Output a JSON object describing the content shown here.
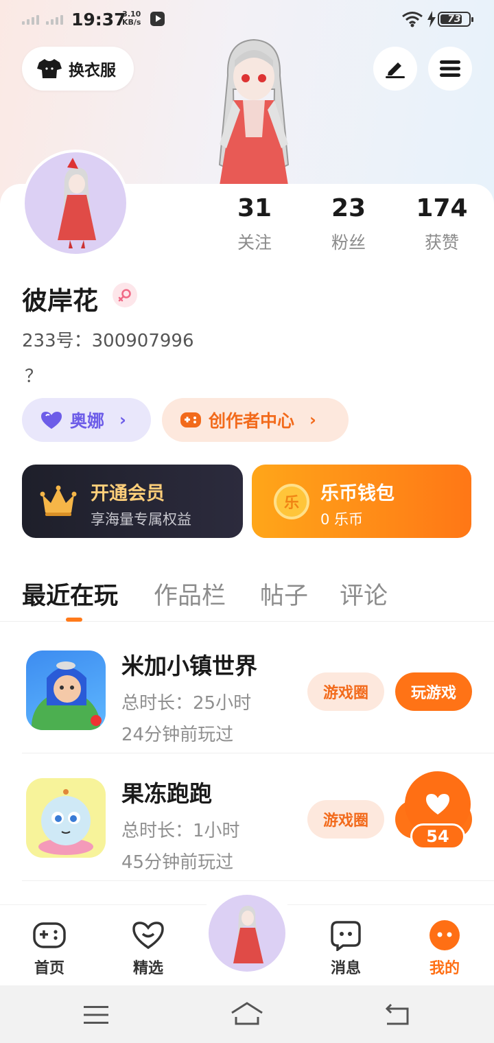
{
  "status_bar": {
    "time": "19:37",
    "net_speed_value": "3.10",
    "net_speed_unit": "KB/s",
    "battery": "73"
  },
  "header": {
    "outfit_label": "换衣服",
    "icons": [
      "tshirt-icon",
      "edit-icon",
      "menu-icon"
    ]
  },
  "profile": {
    "stats": [
      {
        "value": "31",
        "label": "关注"
      },
      {
        "value": "23",
        "label": "粉丝"
      },
      {
        "value": "174",
        "label": "获赞"
      }
    ],
    "nickname": "彼岸花",
    "gender": "female",
    "user_id": "233号：300907996",
    "bio": "？"
  },
  "pills": {
    "ona_label": "奥娜",
    "creator_label": "创作者中心"
  },
  "cards": {
    "vip": {
      "title": "开通会员",
      "subtitle": "享海量专属权益"
    },
    "wallet": {
      "title": "乐币钱包",
      "subtitle": "0 乐币",
      "coin_glyph": "乐"
    }
  },
  "tabs": [
    {
      "label": "最近在玩",
      "active": true
    },
    {
      "label": "作品栏",
      "active": false
    },
    {
      "label": "帖子",
      "active": false
    },
    {
      "label": "评论",
      "active": false
    }
  ],
  "games": [
    {
      "name": "米加小镇世界",
      "total_time": "总时长：25小时",
      "last_played": "24分钟前玩过",
      "circle_label": "游戏圈",
      "play_label": "玩游戏"
    },
    {
      "name": "果冻跑跑",
      "total_time": "总时长：1小时",
      "last_played": "45分钟前玩过",
      "circle_label": "游戏圈",
      "play_label": ""
    }
  ],
  "like_float": {
    "count": "54"
  },
  "bottom_nav": [
    {
      "label": "首页",
      "active": false
    },
    {
      "label": "精选",
      "active": false
    },
    {
      "label": "消息",
      "active": false
    },
    {
      "label": "我的",
      "active": true
    }
  ],
  "colors": {
    "accent": "#ff7316",
    "purple": "#6d5de8",
    "vip_gold": "#ffcf7a"
  }
}
